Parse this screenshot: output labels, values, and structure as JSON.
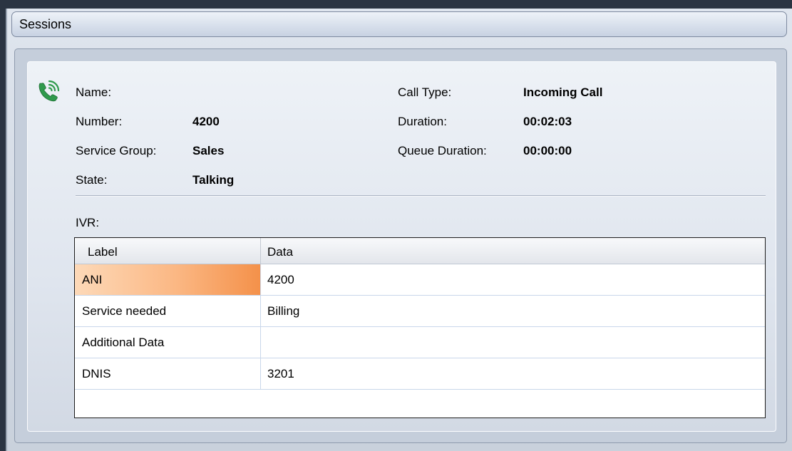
{
  "header": {
    "title": "Sessions"
  },
  "session": {
    "icon": "phone-ringing-icon",
    "left_fields": [
      {
        "label": "Name:",
        "value": ""
      },
      {
        "label": "Number:",
        "value": "4200"
      },
      {
        "label": "Service Group:",
        "value": "Sales"
      },
      {
        "label": "State:",
        "value": "Talking"
      }
    ],
    "right_fields": [
      {
        "label": "Call Type:",
        "value": "Incoming Call"
      },
      {
        "label": "Duration:",
        "value": "00:02:03"
      },
      {
        "label": "Queue Duration:",
        "value": "00:00:00"
      }
    ]
  },
  "ivr": {
    "label": "IVR:",
    "columns": [
      "Label",
      "Data"
    ],
    "rows": [
      {
        "label": "ANI",
        "data": "4200",
        "selected": true
      },
      {
        "label": "Service needed",
        "data": "Billing"
      },
      {
        "label": "Additional Data",
        "data": ""
      },
      {
        "label": "DNIS",
        "data": "3201"
      }
    ]
  },
  "colors": {
    "selection_gradient_end": "#f4914a",
    "phone_icon": "#2f9a4c"
  }
}
